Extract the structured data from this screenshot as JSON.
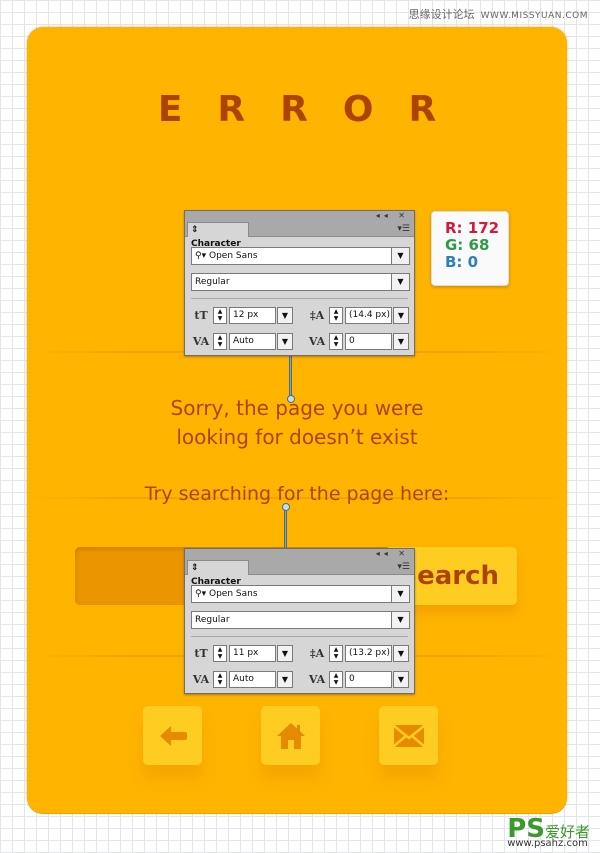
{
  "watermark_top": {
    "site_name": "思缘设计论坛",
    "url": "WWW.MISSYUAN.COM"
  },
  "error_page": {
    "title": "ERROR",
    "message_line1": "Sorry, the page you were",
    "message_line2": "looking for doesn’t exist",
    "search_prompt": "Try searching for the page here:",
    "search_input_value": "",
    "search_button_label": "Search",
    "nav_buttons": [
      {
        "name": "back",
        "icon": "arrow-left-icon"
      },
      {
        "name": "home",
        "icon": "home-icon"
      },
      {
        "name": "contact",
        "icon": "envelope-icon"
      }
    ],
    "colors": {
      "background": "#ffb400",
      "text": "#ac4400",
      "button": "#ffcc22",
      "input": "#eb9500"
    }
  },
  "rgb_callout": {
    "r": "R: 172",
    "g": "G: 68",
    "b": "B: 0"
  },
  "character_panels": [
    {
      "tab_label": "Character",
      "font_family": "Open Sans",
      "font_style": "Regular",
      "font_size": "12 px",
      "leading": "(14.4 px)",
      "kerning": "Auto",
      "tracking": "0"
    },
    {
      "tab_label": "Character",
      "font_family": "Open Sans",
      "font_style": "Regular",
      "font_size": "11 px",
      "leading": "(13.2 px)",
      "kerning": "Auto",
      "tracking": "0"
    }
  ],
  "watermark_bottom": {
    "logo": "PS",
    "site_name": "爱好者",
    "url": "www.psahz.com"
  }
}
